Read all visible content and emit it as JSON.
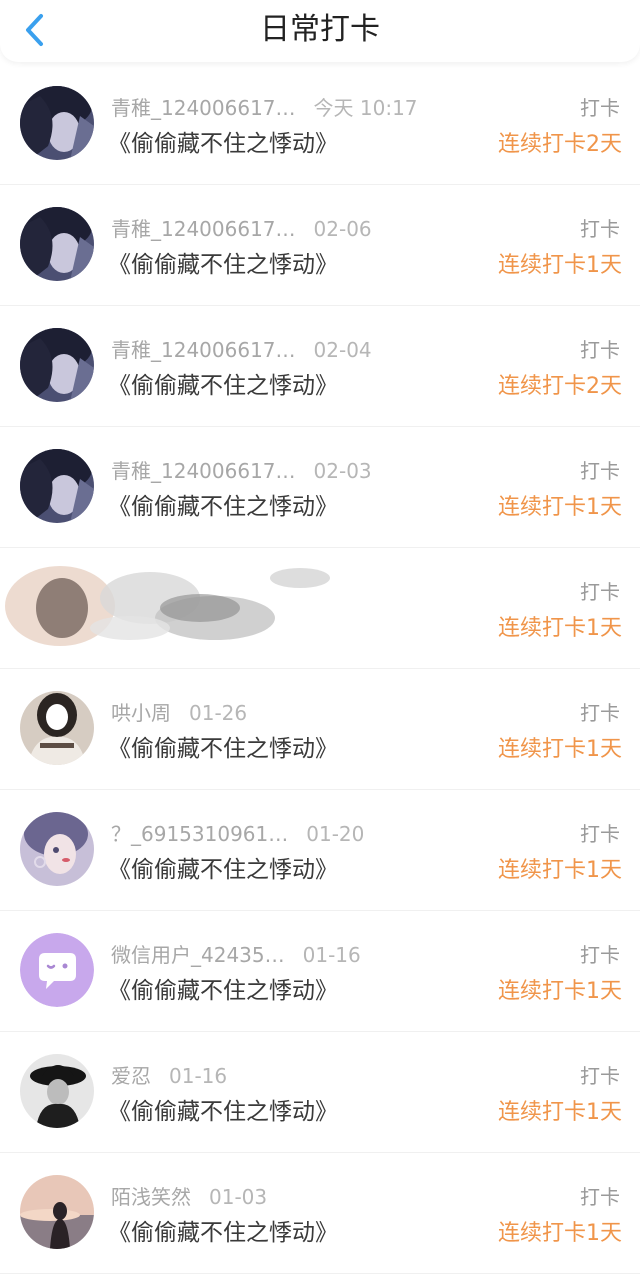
{
  "header": {
    "title": "日常打卡",
    "back_icon": "chevron-left-icon",
    "accent_color": "#3aa0ee"
  },
  "records": [
    {
      "user": "青稚_124006617…",
      "date": "今天 10:17",
      "book": "《偷偷藏不住之悸动》",
      "type": "打卡",
      "streak": "连续打卡2天",
      "avatar": "anime-boy"
    },
    {
      "user": "青稚_124006617…",
      "date": "02-06",
      "book": "《偷偷藏不住之悸动》",
      "type": "打卡",
      "streak": "连续打卡1天",
      "avatar": "anime-boy"
    },
    {
      "user": "青稚_124006617…",
      "date": "02-04",
      "book": "《偷偷藏不住之悸动》",
      "type": "打卡",
      "streak": "连续打卡2天",
      "avatar": "anime-boy"
    },
    {
      "user": "青稚_124006617…",
      "date": "02-03",
      "book": "《偷偷藏不住之悸动》",
      "type": "打卡",
      "streak": "连续打卡1天",
      "avatar": "anime-boy"
    },
    {
      "user": "",
      "date": "",
      "book": "",
      "type": "打卡",
      "streak": "连续打卡1天",
      "avatar": "obscured"
    },
    {
      "user": "哄小周",
      "date": "01-26",
      "book": "《偷偷藏不住之悸动》",
      "type": "打卡",
      "streak": "连续打卡1天",
      "avatar": "girl-photo"
    },
    {
      "user": "？_6915310961…",
      "date": "01-20",
      "book": "《偷偷藏不住之悸动》",
      "type": "打卡",
      "streak": "连续打卡1天",
      "avatar": "anime-girl"
    },
    {
      "user": "微信用户_42435…",
      "date": "01-16",
      "book": "《偷偷藏不住之悸动》",
      "type": "打卡",
      "streak": "连续打卡1天",
      "avatar": "chat-bubble"
    },
    {
      "user": "爱忍",
      "date": "01-16",
      "book": "《偷偷藏不住之悸动》",
      "type": "打卡",
      "streak": "连续打卡1天",
      "avatar": "hat-girl"
    },
    {
      "user": "陌浅笑然",
      "date": "01-03",
      "book": "《偷偷藏不住之悸动》",
      "type": "打卡",
      "streak": "连续打卡1天",
      "avatar": "sunset-girl"
    }
  ]
}
